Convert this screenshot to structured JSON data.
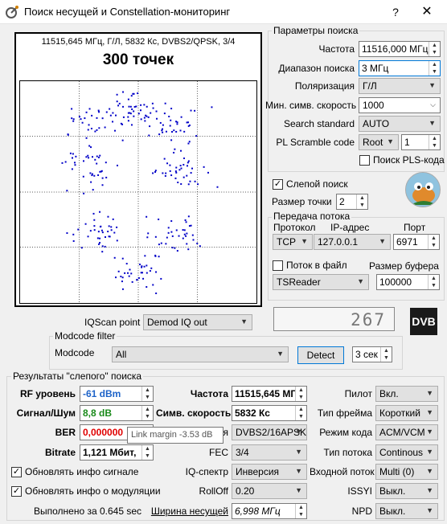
{
  "window": {
    "title": "Поиск несущей и Constellation-мониторинг",
    "help": "?",
    "close": "✕"
  },
  "constellation": {
    "info": "11515,645 МГц, Г/Л, 5832 Кс, DVBS2/QPSK, 3/4",
    "count": "300 точек",
    "points_color": "#0000c8"
  },
  "search_params": {
    "title": "Параметры поиска",
    "frequency_label": "Частота",
    "frequency_value": "11516,000 МГц",
    "range_label": "Диапазон поиска",
    "range_value": "3 МГц",
    "polarization_label": "Поляризация",
    "polarization_value": "Г/Л",
    "min_sr_label": "Мин. симв. скорость",
    "min_sr_value": "1000",
    "search_standard_label": "Search standard",
    "search_standard_value": "AUTO",
    "pl_scramble_label": "PL Scramble code",
    "pl_scramble_mode": "Root",
    "pl_scramble_value": "1",
    "pls_search_label": "Поиск PLS-кода"
  },
  "blind": {
    "label": "Слепой поиск",
    "checked": true,
    "point_size_label": "Размер точки",
    "point_size_value": "2"
  },
  "stream": {
    "title": "Передача потока",
    "protocol_label": "Протокол",
    "ip_label": "IP-адрес",
    "port_label": "Порт",
    "protocol_value": "TCP",
    "ip_value": "127.0.0.1",
    "port_value": "6971",
    "to_file_label": "Поток в файл",
    "buffer_label": "Размер буфера",
    "reader_value": "TSReader",
    "buffer_value": "100000"
  },
  "lcd": {
    "value": "267"
  },
  "dvb_logo": "DVB",
  "iqscan": {
    "label": "IQScan point",
    "value": "Demod IQ out"
  },
  "modcode": {
    "title": "Modcode filter",
    "label": "Modcode",
    "value": "All",
    "detect_label": "Detect",
    "time_value": "3 сек"
  },
  "results": {
    "title": "Результаты \"слепого\" поиска",
    "rf_label": "RF уровень",
    "rf_value": "-61 dBm",
    "rf_color": "#1e63c8",
    "snr_label": "Сигнал/Шум",
    "snr_value": "8,8 dB",
    "snr_color": "#1a8a1a",
    "ber_label": "BER",
    "ber_value": "0,000000",
    "ber_color": "#e00000",
    "bitrate_label": "Bitrate",
    "bitrate_value": "1,121 Мбит,",
    "freq_label": "Частота",
    "freq_value": "11515,645 МГ",
    "sr_label": "Симв. скорость",
    "sr_value": "5832 Кс",
    "mod_value": "DVBS2/16APSK",
    "mod_label_tail": "я",
    "fec_label": "FEC",
    "fec_value": "3/4",
    "iq_label": "IQ-спектр",
    "iq_value": "Инверсия",
    "rolloff_label": "RollOff",
    "rolloff_value": "0.20",
    "bw_label": "Ширина несущей",
    "bw_value": "6,998 МГц",
    "pilot_label": "Пилот",
    "pilot_value": "Вкл.",
    "frame_label": "Тип фрейма",
    "frame_value": "Короткий",
    "code_mode_label": "Режим кода",
    "code_mode_value": "ACM/VCM",
    "stream_type_label": "Тип потока",
    "stream_type_value": "Continous",
    "input_stream_label": "Входной поток",
    "input_stream_value": "Multi (0)",
    "issyi_label": "ISSYI",
    "issyi_value": "Выкл.",
    "npd_label": "NPD",
    "npd_value": "Выкл.",
    "update_signal_label": "Обновлять инфо сигнале",
    "update_mod_label": "Обновлять инфо о модуляции",
    "done_label": "Выполнено за 0.645 sec",
    "tooltip": "Link margin -3.53 dB"
  }
}
